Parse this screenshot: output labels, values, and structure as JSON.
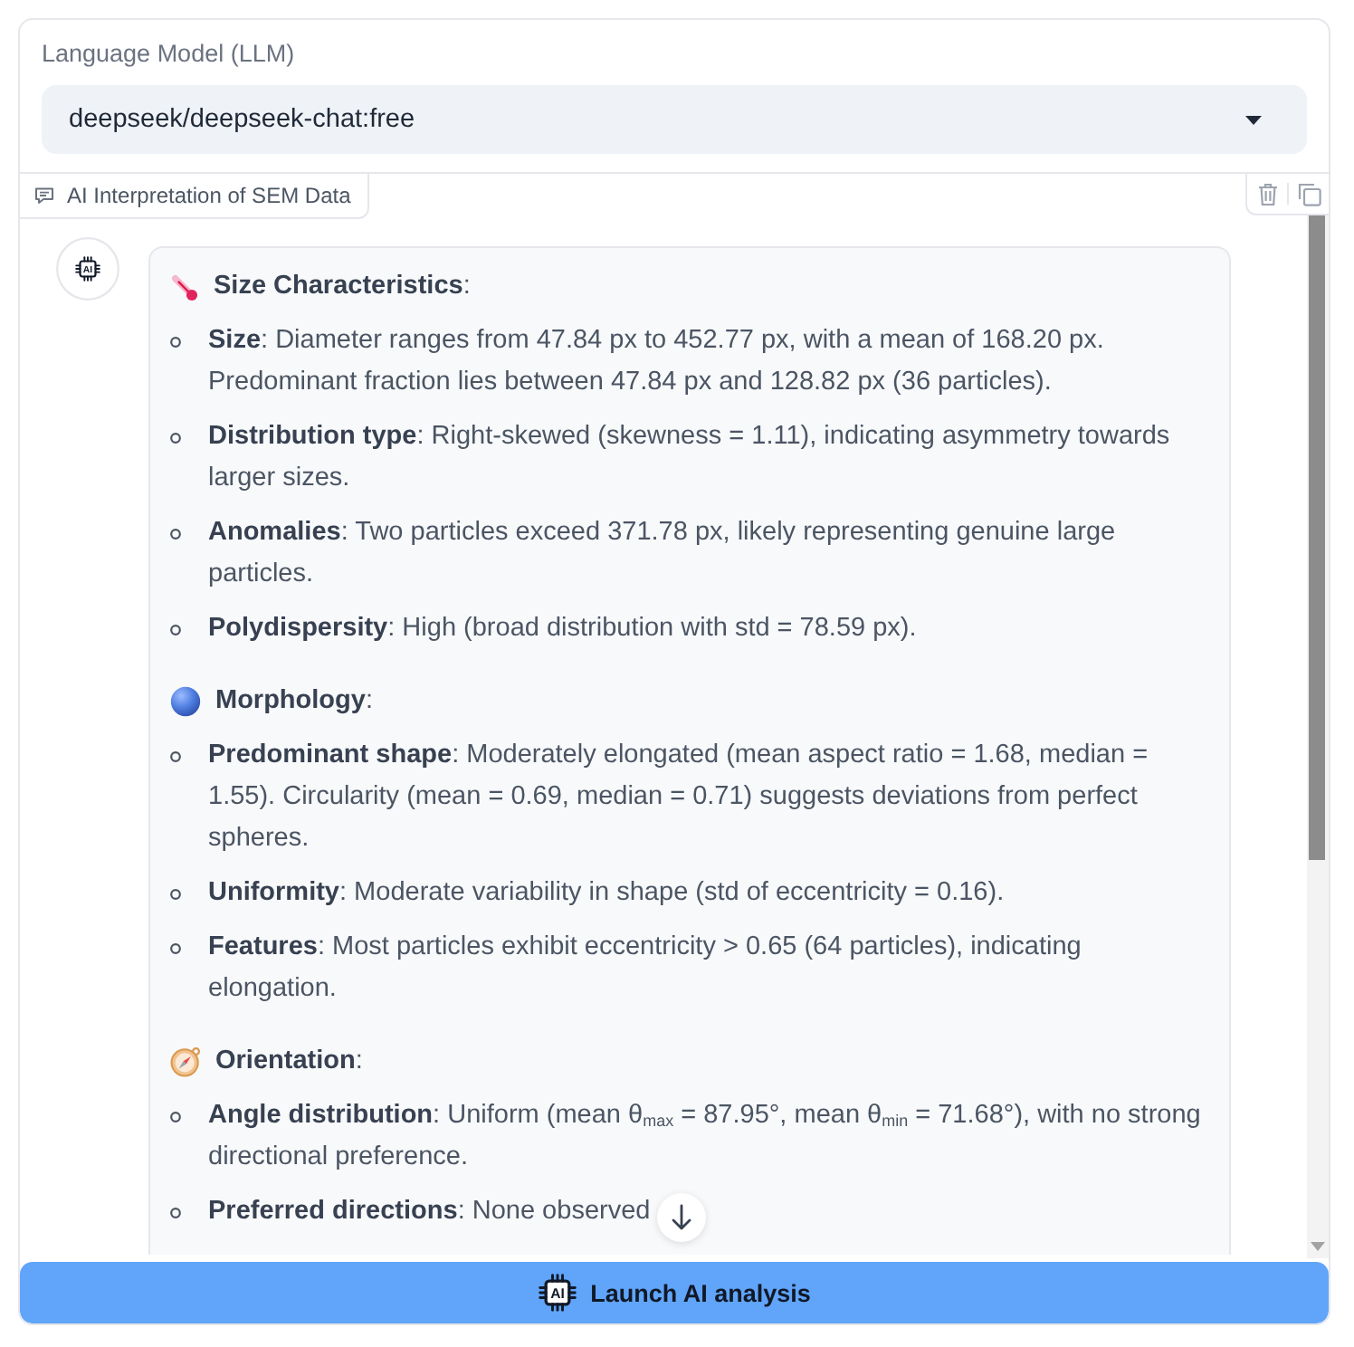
{
  "model_selector": {
    "label": "Language Model (LLM)",
    "value": "deepseek/deepseek-chat:free"
  },
  "chat": {
    "label": "AI Interpretation of SEM Data",
    "avatar_text": "AI",
    "message": {
      "sections": [
        {
          "heading": "**Size Characteristics**:",
          "items": [
            "**Size**: Diameter ranges from 47.84 px to 452.77 px, with a mean of 168.20 px. Predominant fraction lies between 47.84 px and 128.82 px (36 particles).",
            "**Distribution type**: Right-skewed (skewness = 1.11), indicating asymmetry towards larger sizes.",
            "**Anomalies**: Two particles exceed 371.78 px, likely representing genuine large particles.",
            "**Polydispersity**: High (broad distribution with std = 78.59 px)."
          ]
        },
        {
          "heading": "**Morphology**:",
          "items": [
            "**Predominant shape**: Moderately elongated (mean aspect ratio = 1.68, median = 1.55). Circularity (mean = 0.69, median = 0.71) suggests deviations from perfect spheres.",
            "**Uniformity**: Moderate variability in shape (std of eccentricity = 0.16).",
            "**Features**: Most particles exhibit eccentricity > 0.65 (64 particles), indicating elongation."
          ]
        },
        {
          "heading": "**Orientation**:",
          "items": [
            "**Angle distribution**: Uniform (mean θ$_{max}$ = 87.95°, mean θ$_{min}$ = 71.68°), with no strong directional preference.",
            "**Preferred directions**: None observed"
          ]
        }
      ]
    }
  },
  "launch_button": {
    "icon_text": "AI",
    "label": "Launch AI analysis"
  }
}
